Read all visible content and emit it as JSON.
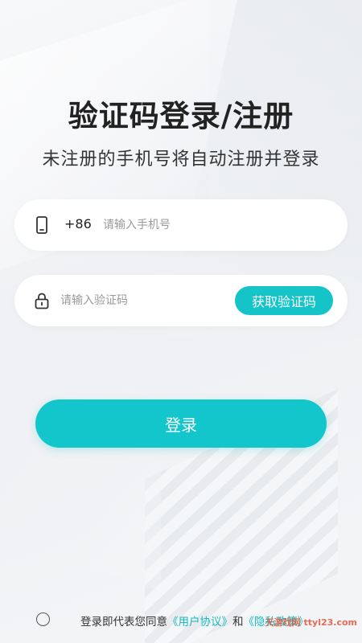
{
  "header": {
    "title": "验证码登录/注册",
    "subtitle": "未注册的手机号将自动注册并登录"
  },
  "phone_field": {
    "icon": "phone-icon",
    "country_code": "+86",
    "placeholder": "请输入手机号",
    "value": ""
  },
  "code_field": {
    "icon": "lock-icon",
    "placeholder": "请输入验证码",
    "value": "",
    "get_code_label": "获取验证码"
  },
  "login_button": {
    "label": "登录"
  },
  "agreement": {
    "checked": false,
    "prefix": "登录即代表您同意",
    "user_agreement": "《用户协议》",
    "and": "和",
    "privacy_policy": "《隐私政策》"
  },
  "watermark": {
    "text": "天游戏网 ttyl23.com"
  },
  "colors": {
    "accent": "#13c6cb",
    "link": "#14b9c0",
    "title": "#222222",
    "background": "#f2f3f5"
  }
}
